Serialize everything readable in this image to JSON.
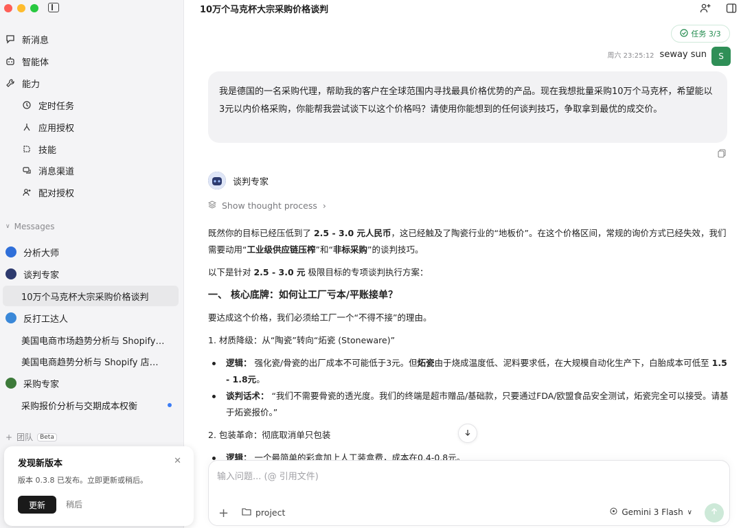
{
  "sidebar": {
    "nav": [
      {
        "label": "新消息",
        "icon": "new-message-icon"
      },
      {
        "label": "智能体",
        "icon": "agent-icon"
      },
      {
        "label": "能力",
        "icon": "wrench-icon"
      }
    ],
    "capabilities": [
      {
        "label": "定时任务",
        "icon": "clock-icon"
      },
      {
        "label": "应用授权",
        "icon": "app-auth-icon"
      },
      {
        "label": "技能",
        "icon": "skill-icon"
      },
      {
        "label": "消息渠道",
        "icon": "channel-icon"
      },
      {
        "label": "配对授权",
        "icon": "pairing-icon"
      }
    ],
    "messages_label": "Messages",
    "chats": [
      {
        "label": "分析大师",
        "avatar_color": "#2f6fd9"
      },
      {
        "label": "谈判专家",
        "avatar_color": "#2d3a6e"
      },
      {
        "label": "10万个马克杯大宗采购价格谈判"
      },
      {
        "label": "反打工达人",
        "avatar_color": "#3a88d8"
      },
      {
        "label": "美国电商市场趋势分析与 Shopify ..."
      },
      {
        "label": "美国电商趋势分析与 Shopify 店铺..."
      },
      {
        "label": "采购专家",
        "avatar_color": "#3d7a3a"
      },
      {
        "label": "采购报价分析与交期成本权衡"
      }
    ],
    "team_label": "团队",
    "beta_label": "Beta",
    "update": {
      "title": "发现新版本",
      "desc": "版本 0.3.8 已发布。立即更新或稍后。",
      "update_btn": "更新",
      "later_btn": "稍后"
    }
  },
  "header": {
    "title": "10万个马克杯大宗采购价格谈判",
    "task_badge": "任务 3/3"
  },
  "user_msg": {
    "time": "周六 23:25:12",
    "user": "seway sun",
    "avatar_letter": "S",
    "text": "我是德国的一名采购代理，帮助我的客户在全球范围内寻找最具价格优势的产品。现在我想批量采购10万个马克杯，希望能以3元以内价格采购，你能帮我尝试谈下以这个价格吗？请使用你能想到的任何谈判技巧，争取拿到最优的成交价。"
  },
  "bot": {
    "name": "谈判专家",
    "thought": "Show thought process",
    "p1_a": "既然你的目标已经压低到了 ",
    "p1_b": "2.5 - 3.0 元人民币",
    "p1_c": "，这已经触及了陶瓷行业的“地板价”。在这个价格区间，常规的询价方式已经失效，我们需要动用“",
    "p1_d": "工业级供应链压榨",
    "p1_e": "”和“",
    "p1_f": "非标采购",
    "p1_g": "”的谈判技巧。",
    "p2_a": "以下是针对 ",
    "p2_b": "2.5 - 3.0 元",
    "p2_c": " 极限目标的专项谈判执行方案：",
    "h1": "一、 核心底牌：如何让工厂亏本/平账接单？",
    "p3": "要达成这个价格，我们必须给工厂一个“不得不接”的理由。",
    "s1": "1. 材质降级：从“陶瓷”转向“炻瓷 (Stoneware)”",
    "b1_label": "逻辑：",
    "b1_a": " 强化瓷/骨瓷的出厂成本不可能低于3元。但",
    "b1_b": "炻瓷",
    "b1_c": "由于烧成温度低、泥料要求低，在大规模自动化生产下，白胎成本可低至 ",
    "b1_d": "1.5 - 1.8元",
    "b1_e": "。",
    "b2_label": "谈判话术：",
    "b2_text": " “我们不需要骨瓷的透光度。我们的终端是超市赠品/基础款，只要通过FDA/欧盟食品安全测试，炻瓷完全可以接受。请基于炻瓷报价。”",
    "s2": "2. 包装革命：彻底取消单只包装",
    "b3_label": "逻辑：",
    "b3_text": " 一个最简单的彩盒加上人工装盒费，成本在0.4-0.8元。"
  },
  "input": {
    "placeholder": "输入问题... (@ 引用文件)",
    "project": "project",
    "model": "Gemini 3 Flash"
  },
  "colors": {
    "accent_green": "#2f8f57",
    "unread_dot": "#3b7cf5"
  }
}
